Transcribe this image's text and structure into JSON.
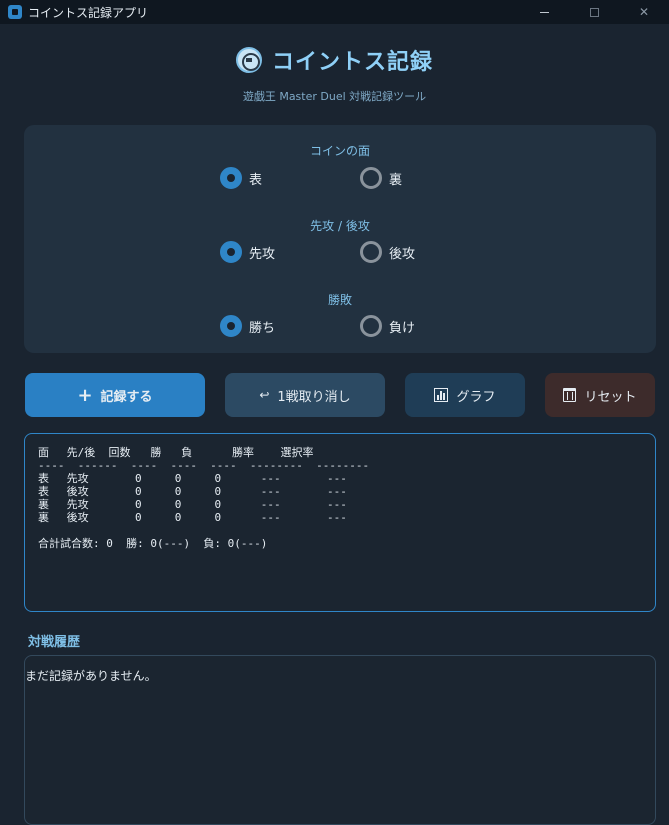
{
  "window": {
    "title": "コイントス記録アプリ"
  },
  "header": {
    "title": "コイントス記録",
    "subtitle": "遊戯王 Master Duel 対戦記録ツール"
  },
  "options": {
    "coin_face": {
      "label": "コインの面",
      "options": [
        "表",
        "裏"
      ],
      "selected": "表"
    },
    "turn_order": {
      "label": "先攻 / 後攻",
      "options": [
        "先攻",
        "後攻"
      ],
      "selected": "先攻"
    },
    "result": {
      "label": "勝敗",
      "options": [
        "勝ち",
        "負け"
      ],
      "selected": "勝ち"
    }
  },
  "buttons": {
    "record": "記録する",
    "undo": "1戦取り消し",
    "graph": "グラフ",
    "reset": "リセット"
  },
  "stats": {
    "text": "面　 先/後  回数   勝   負      勝率    選択率\n----  ------  ----  ----  ----  --------  --------\n表　 先攻       0     0     0      ---       ---\n表　 後攻       0     0     0      ---       ---\n裏　 先攻       0     0     0      ---       ---\n裏　 後攻       0     0     0      ---       ---\n\n合計試合数: 0  勝: 0(---)  負: 0(---)"
  },
  "history": {
    "label": "対戦履歴",
    "empty_message": "まだ記録がありません。"
  },
  "colors": {
    "accent": "#2f86c8",
    "background": "#1a2430",
    "panel": "#223140",
    "reset_button": "#3d2b2b"
  },
  "icons": [
    "app-icon",
    "coin-icon",
    "plus-icon",
    "undo-icon",
    "bar-chart-icon",
    "trash-icon"
  ]
}
